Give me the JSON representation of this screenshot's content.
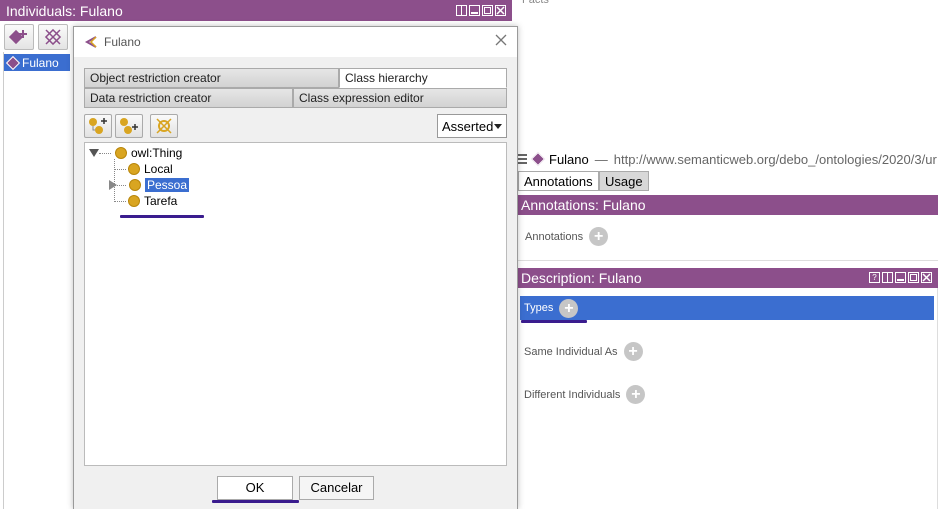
{
  "individuals": {
    "header": "Individuals: Fulano",
    "items": [
      {
        "label": "Fulano"
      }
    ]
  },
  "top_faint": "Facts",
  "dialog": {
    "title": "Fulano",
    "tabs_row1": [
      {
        "label": "Object restriction creator"
      },
      {
        "label": "Class hierarchy"
      }
    ],
    "tabs_row2": [
      {
        "label": "Data restriction creator"
      },
      {
        "label": "Class expression editor"
      }
    ],
    "selected_tab": "Class hierarchy",
    "view_mode": "Asserted",
    "tree": {
      "root": "owl:Thing",
      "children": [
        {
          "label": "Local"
        },
        {
          "label": "Pessoa"
        },
        {
          "label": "Tarefa"
        }
      ],
      "selected": "Pessoa"
    },
    "ok_label": "OK",
    "cancel_label": "Cancelar"
  },
  "right": {
    "entity": "Fulano",
    "separator": "—",
    "iri": "http://www.semanticweb.org/debo_/ontologies/2020/3/ur",
    "tabs": [
      {
        "label": "Annotations"
      },
      {
        "label": "Usage"
      }
    ],
    "annotations_header": "Annotations: Fulano",
    "annotations_label": "Annotations",
    "description_header": "Description: Fulano",
    "types_label": "Types",
    "same_individual_label": "Same Individual As",
    "different_individuals_label": "Different Individuals"
  },
  "colors": {
    "header_purple": "#8c4f8b",
    "selection_blue": "#3b6ed0",
    "class_gold": "#d9a521",
    "underline_annotation": "#3a1c8e"
  }
}
